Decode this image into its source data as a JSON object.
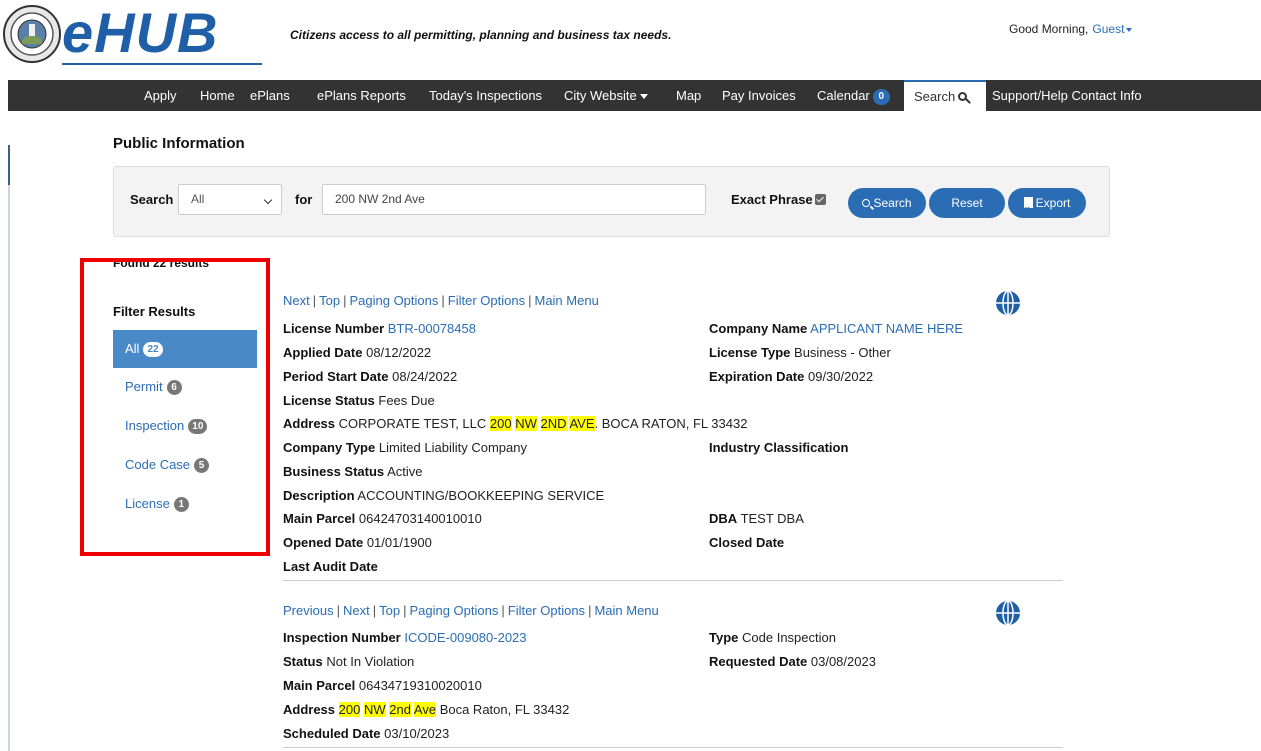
{
  "header": {
    "logo_text": "eHUB",
    "tagline": "Citizens access to all permitting, planning and business tax needs.",
    "greeting": "Good Morning,",
    "user": "Guest"
  },
  "nav": {
    "items": [
      "Apply",
      "Home",
      "ePlans",
      "ePlans Reports",
      "Today's Inspections",
      "City Website",
      "Map",
      "Pay Invoices",
      "Calendar",
      "Search",
      "Support/Help Contact Info"
    ],
    "calendar_badge": "0"
  },
  "page": {
    "title": "Public Information"
  },
  "search": {
    "label": "Search",
    "scope": "All",
    "for_label": "for",
    "query": "200 NW 2nd Ave",
    "exact_phrase_label": "Exact Phrase",
    "exact_phrase_checked": true,
    "search_button": "Search",
    "reset_button": "Reset",
    "export_button": "Export"
  },
  "filters": {
    "found": "Found 22 results",
    "title": "Filter Results",
    "items": [
      {
        "label": "All",
        "count": "22"
      },
      {
        "label": "Permit",
        "count": "6"
      },
      {
        "label": "Inspection",
        "count": "10"
      },
      {
        "label": "Code Case",
        "count": "5"
      },
      {
        "label": "License",
        "count": "1"
      }
    ]
  },
  "result1": {
    "links": [
      "Next",
      "Top",
      "Paging Options",
      "Filter Options",
      "Main Menu"
    ],
    "license_number_label": "License Number",
    "license_number": "BTR-00078458",
    "company_name_label": "Company Name",
    "company_name": "APPLICANT NAME HERE",
    "applied_date_label": "Applied Date",
    "applied_date": "08/12/2022",
    "license_type_label": "License Type",
    "license_type": "Business - Other",
    "period_start_label": "Period Start Date",
    "period_start": "08/24/2022",
    "expiration_label": "Expiration Date",
    "expiration": "09/30/2022",
    "license_status_label": "License Status",
    "license_status": "Fees Due",
    "address_label": "Address",
    "address_pre": "CORPORATE TEST, LLC",
    "address_hl1": "200",
    "address_hl2": "NW",
    "address_hl3": "2ND",
    "address_hl4": "AVE",
    "address_post": ". BOCA RATON, FL 33432",
    "company_type_label": "Company Type",
    "company_type": "Limited Liability Company",
    "industry_label": "Industry Classification",
    "business_status_label": "Business Status",
    "business_status": "Active",
    "description_label": "Description",
    "description": "ACCOUNTING/BOOKKEEPING SERVICE",
    "main_parcel_label": "Main Parcel",
    "main_parcel": "06424703140010010",
    "dba_label": "DBA",
    "dba": "TEST DBA",
    "opened_label": "Opened Date",
    "opened": "01/01/1900",
    "closed_label": "Closed Date",
    "last_audit_label": "Last Audit Date"
  },
  "result2": {
    "links": [
      "Previous",
      "Next",
      "Top",
      "Paging Options",
      "Filter Options",
      "Main Menu"
    ],
    "inspection_number_label": "Inspection Number",
    "inspection_number": "ICODE-009080-2023",
    "type_label": "Type",
    "type": "Code Inspection",
    "status_label": "Status",
    "status": "Not In Violation",
    "requested_label": "Requested Date",
    "requested": "03/08/2023",
    "main_parcel_label": "Main Parcel",
    "main_parcel": "06434719310020010",
    "address_label": "Address",
    "address_hl1": "200",
    "address_hl2": "NW",
    "address_hl3": "2nd",
    "address_hl4": "Ave",
    "address_post": "Boca Raton, FL 33432",
    "scheduled_label": "Scheduled Date",
    "scheduled": "03/10/2023"
  },
  "colors": {
    "brand_blue": "#2a6db5",
    "nav_bg": "#333333",
    "active_filter": "#4a89c8",
    "highlight": "#ffff00",
    "annotation_red": "#ee0000"
  }
}
